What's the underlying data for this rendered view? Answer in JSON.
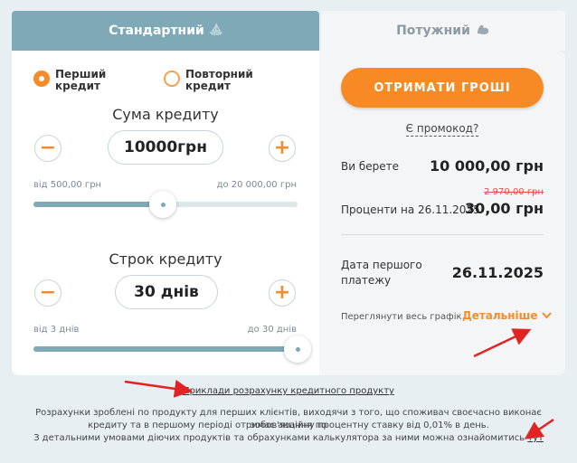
{
  "tabs": {
    "standard": "Стандартний",
    "powerful": "Потужний"
  },
  "loan_type": {
    "first": "Перший кредит",
    "repeat": "Повторний кредит",
    "selected": "first"
  },
  "amount": {
    "title": "Сума кредиту",
    "value": "10000грн",
    "min_label": "від 500,00 грн",
    "max_label": "до 20 000,00 грн",
    "minus": "−",
    "plus": "+",
    "slider_fraction": 0.49
  },
  "term": {
    "title": "Строк кредиту",
    "value": "30 днів",
    "min_label": "від 3 днів",
    "max_label": "до 30 днів",
    "minus": "−",
    "plus": "+",
    "slider_fraction": 1.0
  },
  "summary": {
    "cta": "ОТРИМАТИ ГРОШІ",
    "promo": "Є промокод?",
    "take_label": "Ви берете",
    "take_value": "10 000,00 грн",
    "interest_label": "Проценти на 26.11.2025",
    "interest_old": "2 970,00 грн",
    "interest_value": "30,00 грн",
    "first_payment_label": "Дата першого платежу",
    "first_payment_value": "26.11.2025",
    "schedule_label": "Переглянути весь графік",
    "details_link": "Детальніше"
  },
  "footer": {
    "examples_link": "Приклади розрахунку кредитного продукту",
    "note_line1": "Розрахунки зроблені по продукту для перших клієнтів, виходячи з того, що споживач своєчасно виконає зобов'язання по",
    "note_line2": "кредиту та в першому періоді отримає акційну процентну ставку від 0,01% в день.",
    "note_line3": "З детальними умовами діючих продуктів та обрахунками калькулятора за ними можна ознайомитись",
    "here_link": "тут"
  },
  "colors": {
    "accent": "#f78a24",
    "tab_active": "#7fa9b6",
    "annotation_arrow": "#e02424"
  }
}
